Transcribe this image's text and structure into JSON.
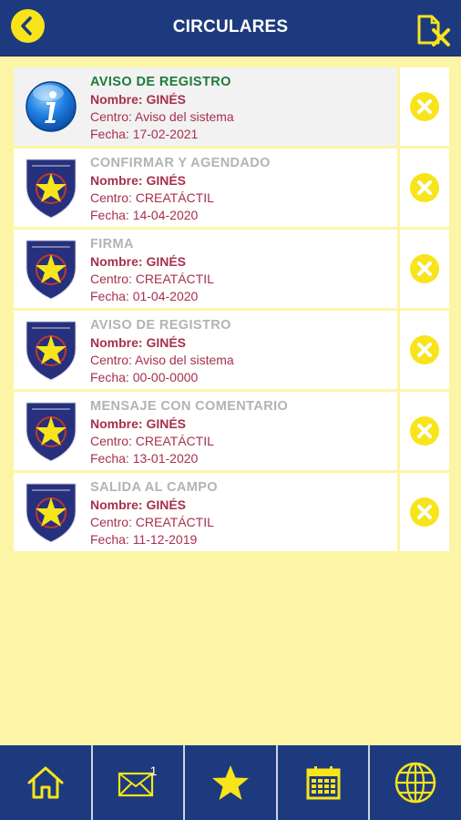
{
  "header": {
    "title": "CIRCULARES"
  },
  "circulars": [
    {
      "title": "AVISO DE REGISTRO",
      "name": "Nombre: GINÉS",
      "center": "Centro: Aviso del sistema",
      "date": "Fecha: 17-02-2021",
      "icon": "info-icon",
      "unread": true
    },
    {
      "title": "CONFIRMAR Y AGENDADO",
      "name": "Nombre: GINÉS",
      "center": "Centro: CREATÁCTIL",
      "date": "Fecha: 14-04-2020",
      "icon": "salesianos-crest-icon",
      "unread": false
    },
    {
      "title": "FIRMA",
      "name": "Nombre: GINÉS",
      "center": "Centro: CREATÁCTIL",
      "date": "Fecha: 01-04-2020",
      "icon": "salesianos-crest-icon",
      "unread": false
    },
    {
      "title": "AVISO DE REGISTRO",
      "name": "Nombre: GINÉS",
      "center": "Centro: Aviso del sistema",
      "date": "Fecha: 00-00-0000",
      "icon": "salesianos-crest-icon",
      "unread": false
    },
    {
      "title": "MENSAJE CON COMENTARIO",
      "name": "Nombre: GINÉS",
      "center": "Centro: CREATÁCTIL",
      "date": "Fecha: 13-01-2020",
      "icon": "salesianos-crest-icon",
      "unread": false
    },
    {
      "title": "SALIDA AL CAMPO",
      "name": "Nombre: GINÉS",
      "center": "Centro: CREATÁCTIL",
      "date": "Fecha: 11-12-2019",
      "icon": "salesianos-crest-icon",
      "unread": false
    }
  ],
  "tabbar": {
    "tabs": [
      {
        "icon": "home-icon"
      },
      {
        "icon": "mail-icon",
        "badge": "1"
      },
      {
        "icon": "star-icon"
      },
      {
        "icon": "calendar-icon"
      },
      {
        "icon": "globe-icon"
      }
    ]
  },
  "colors": {
    "header": "#1e3a7e",
    "accent": "#f7e41b",
    "background": "#fdf5a6",
    "unread_title": "#1f7a3a",
    "detail_text": "#a8304d"
  }
}
